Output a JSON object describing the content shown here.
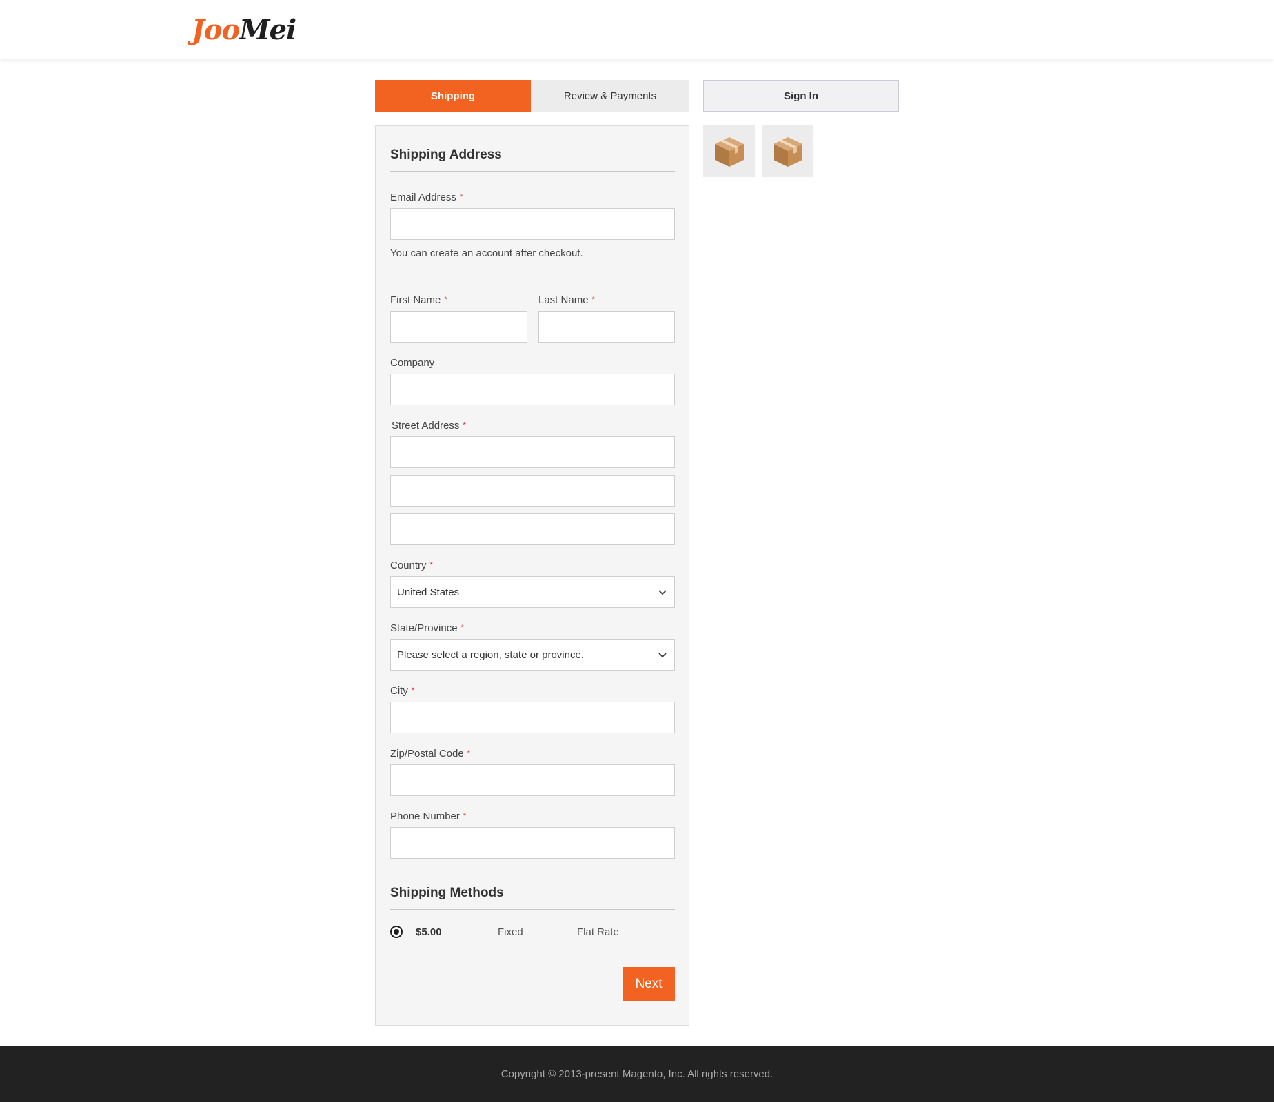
{
  "header": {
    "logo_part1": "Joo",
    "logo_part2": "Mei"
  },
  "tabs": [
    {
      "label": "Shipping",
      "active": true
    },
    {
      "label": "Review & Payments",
      "active": false
    }
  ],
  "sidebar": {
    "signin_label": "Sign In",
    "item_icons": [
      "box-icon",
      "box-icon"
    ]
  },
  "form": {
    "title": "Shipping Address",
    "email": {
      "label": "Email Address",
      "value": ""
    },
    "email_note": "You can create an account after checkout.",
    "first_name": {
      "label": "First Name",
      "value": ""
    },
    "last_name": {
      "label": "Last Name",
      "value": ""
    },
    "company": {
      "label": "Company",
      "value": ""
    },
    "street": {
      "label": "Street Address",
      "lines": [
        "",
        "",
        ""
      ]
    },
    "country": {
      "label": "Country",
      "value": "United States"
    },
    "state": {
      "label": "State/Province",
      "value": "Please select a region, state or province."
    },
    "city": {
      "label": "City",
      "value": ""
    },
    "zip": {
      "label": "Zip/Postal Code",
      "value": ""
    },
    "phone": {
      "label": "Phone Number",
      "value": ""
    },
    "required_mark": "*"
  },
  "shipping_methods": {
    "title": "Shipping Methods",
    "options": [
      {
        "price": "$5.00",
        "method": "Fixed",
        "carrier": "Flat Rate",
        "selected": true
      }
    ]
  },
  "next_label": "Next",
  "footer": {
    "copyright": "Copyright © 2013-present Magento, Inc. All rights reserved."
  },
  "colors": {
    "accent": "#f26322",
    "footer_bg": "#222222",
    "required": "#e02b27"
  }
}
